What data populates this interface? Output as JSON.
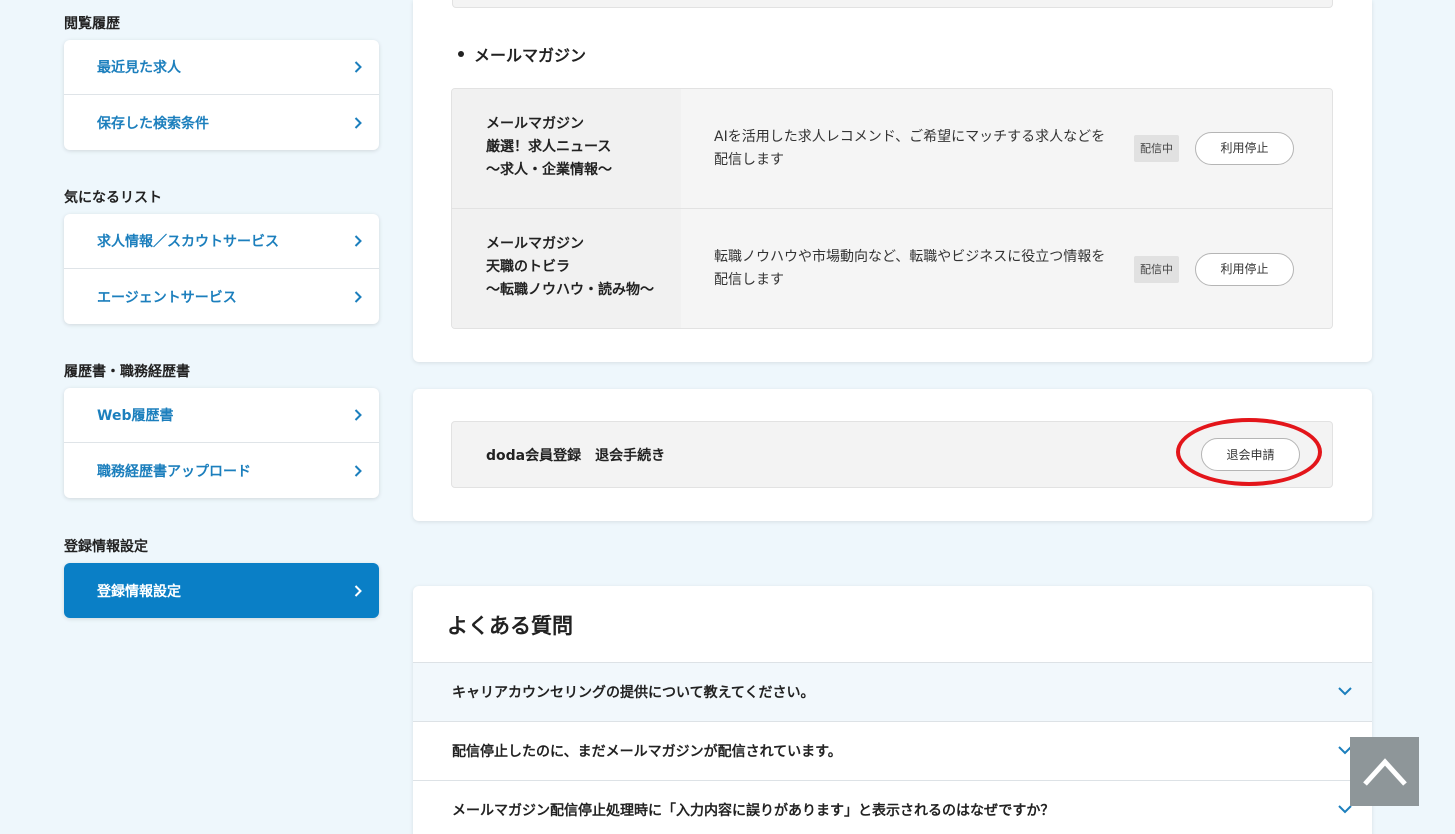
{
  "sidebar": {
    "sections": [
      {
        "title": "閲覧履歴",
        "items": [
          "最近見た求人",
          "保存した検索条件"
        ]
      },
      {
        "title": "気になるリスト",
        "items": [
          "求人情報／スカウトサービス",
          "エージェントサービス"
        ]
      },
      {
        "title": "履歴書・職務経歴書",
        "items": [
          "Web履歴書",
          "職務経歴書アップロード"
        ]
      },
      {
        "title": "登録情報設定",
        "items": [
          "登録情報設定"
        ]
      }
    ]
  },
  "mail_magazine": {
    "heading": "メールマガジン",
    "rows": [
      {
        "name_lines": [
          "メールマガジン",
          "厳選！求人ニュース",
          "〜求人・企業情報〜"
        ],
        "description": "AIを活用した求人レコメンド、ご希望にマッチする求人などを配信します",
        "status": "配信中",
        "button": "利用停止"
      },
      {
        "name_lines": [
          "メールマガジン",
          "天職のトビラ",
          "〜転職ノウハウ・読み物〜"
        ],
        "description": "転職ノウハウや市場動向など、転職やビジネスに役立つ情報を配信します",
        "status": "配信中",
        "button": "利用停止"
      }
    ]
  },
  "withdrawal": {
    "label": "doda会員登録　退会手続き",
    "button": "退会申請"
  },
  "faq": {
    "title": "よくある質問",
    "items": [
      "キャリアカウンセリングの提供について教えてください。",
      "配信停止したのに、まだメールマガジンが配信されています。",
      "メールマガジン配信停止処理時に「入力内容に誤りがあります」と表示されるのはなぜですか？"
    ]
  },
  "icons": {
    "chevron_right": "chevron-right-icon",
    "chevron_down": "chevron-down-icon",
    "back_to_top": "arrow-up-icon"
  },
  "colors": {
    "link": "#1c7fbd",
    "active": "#0a7fc6",
    "highlight": "#e3151a"
  }
}
